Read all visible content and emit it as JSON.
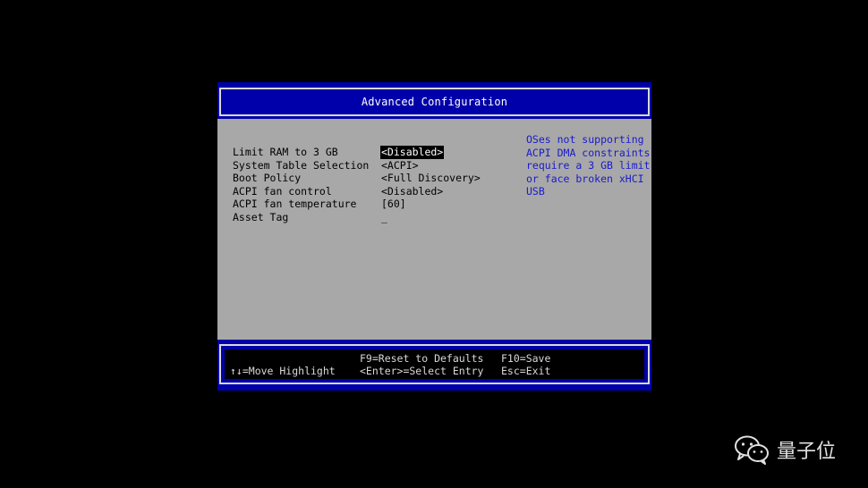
{
  "window": {
    "title": "Advanced Configuration"
  },
  "settings": [
    {
      "label": "Limit RAM to 3 GB",
      "value": "<Disabled>",
      "selected": true
    },
    {
      "label": "System Table Selection",
      "value": "<ACPI>"
    },
    {
      "label": "Boot Policy",
      "value": "<Full Discovery>"
    },
    {
      "label": "ACPI fan control",
      "value": "<Disabled>"
    },
    {
      "label": "ACPI fan temperature",
      "value": "[60]"
    },
    {
      "label": "Asset Tag",
      "value": "_"
    }
  ],
  "help": {
    "lines": [
      "OSes not supporting",
      "ACPI DMA constraints",
      "require a 3 GB limit",
      "or face broken xHCI",
      "USB"
    ]
  },
  "footer": {
    "move": "↑↓=Move Highlight",
    "reset": "F9=Reset to Defaults",
    "select": "<Enter>=Select Entry",
    "save": "F10=Save",
    "exit": "Esc=Exit"
  },
  "watermark": {
    "text": "量子位",
    "icon": "wechat-icon"
  },
  "colors": {
    "bios_blue": "#0000aa",
    "panel_gray": "#a8a8a8",
    "help_text": "#1a1acc",
    "highlight_bg": "#000000"
  }
}
